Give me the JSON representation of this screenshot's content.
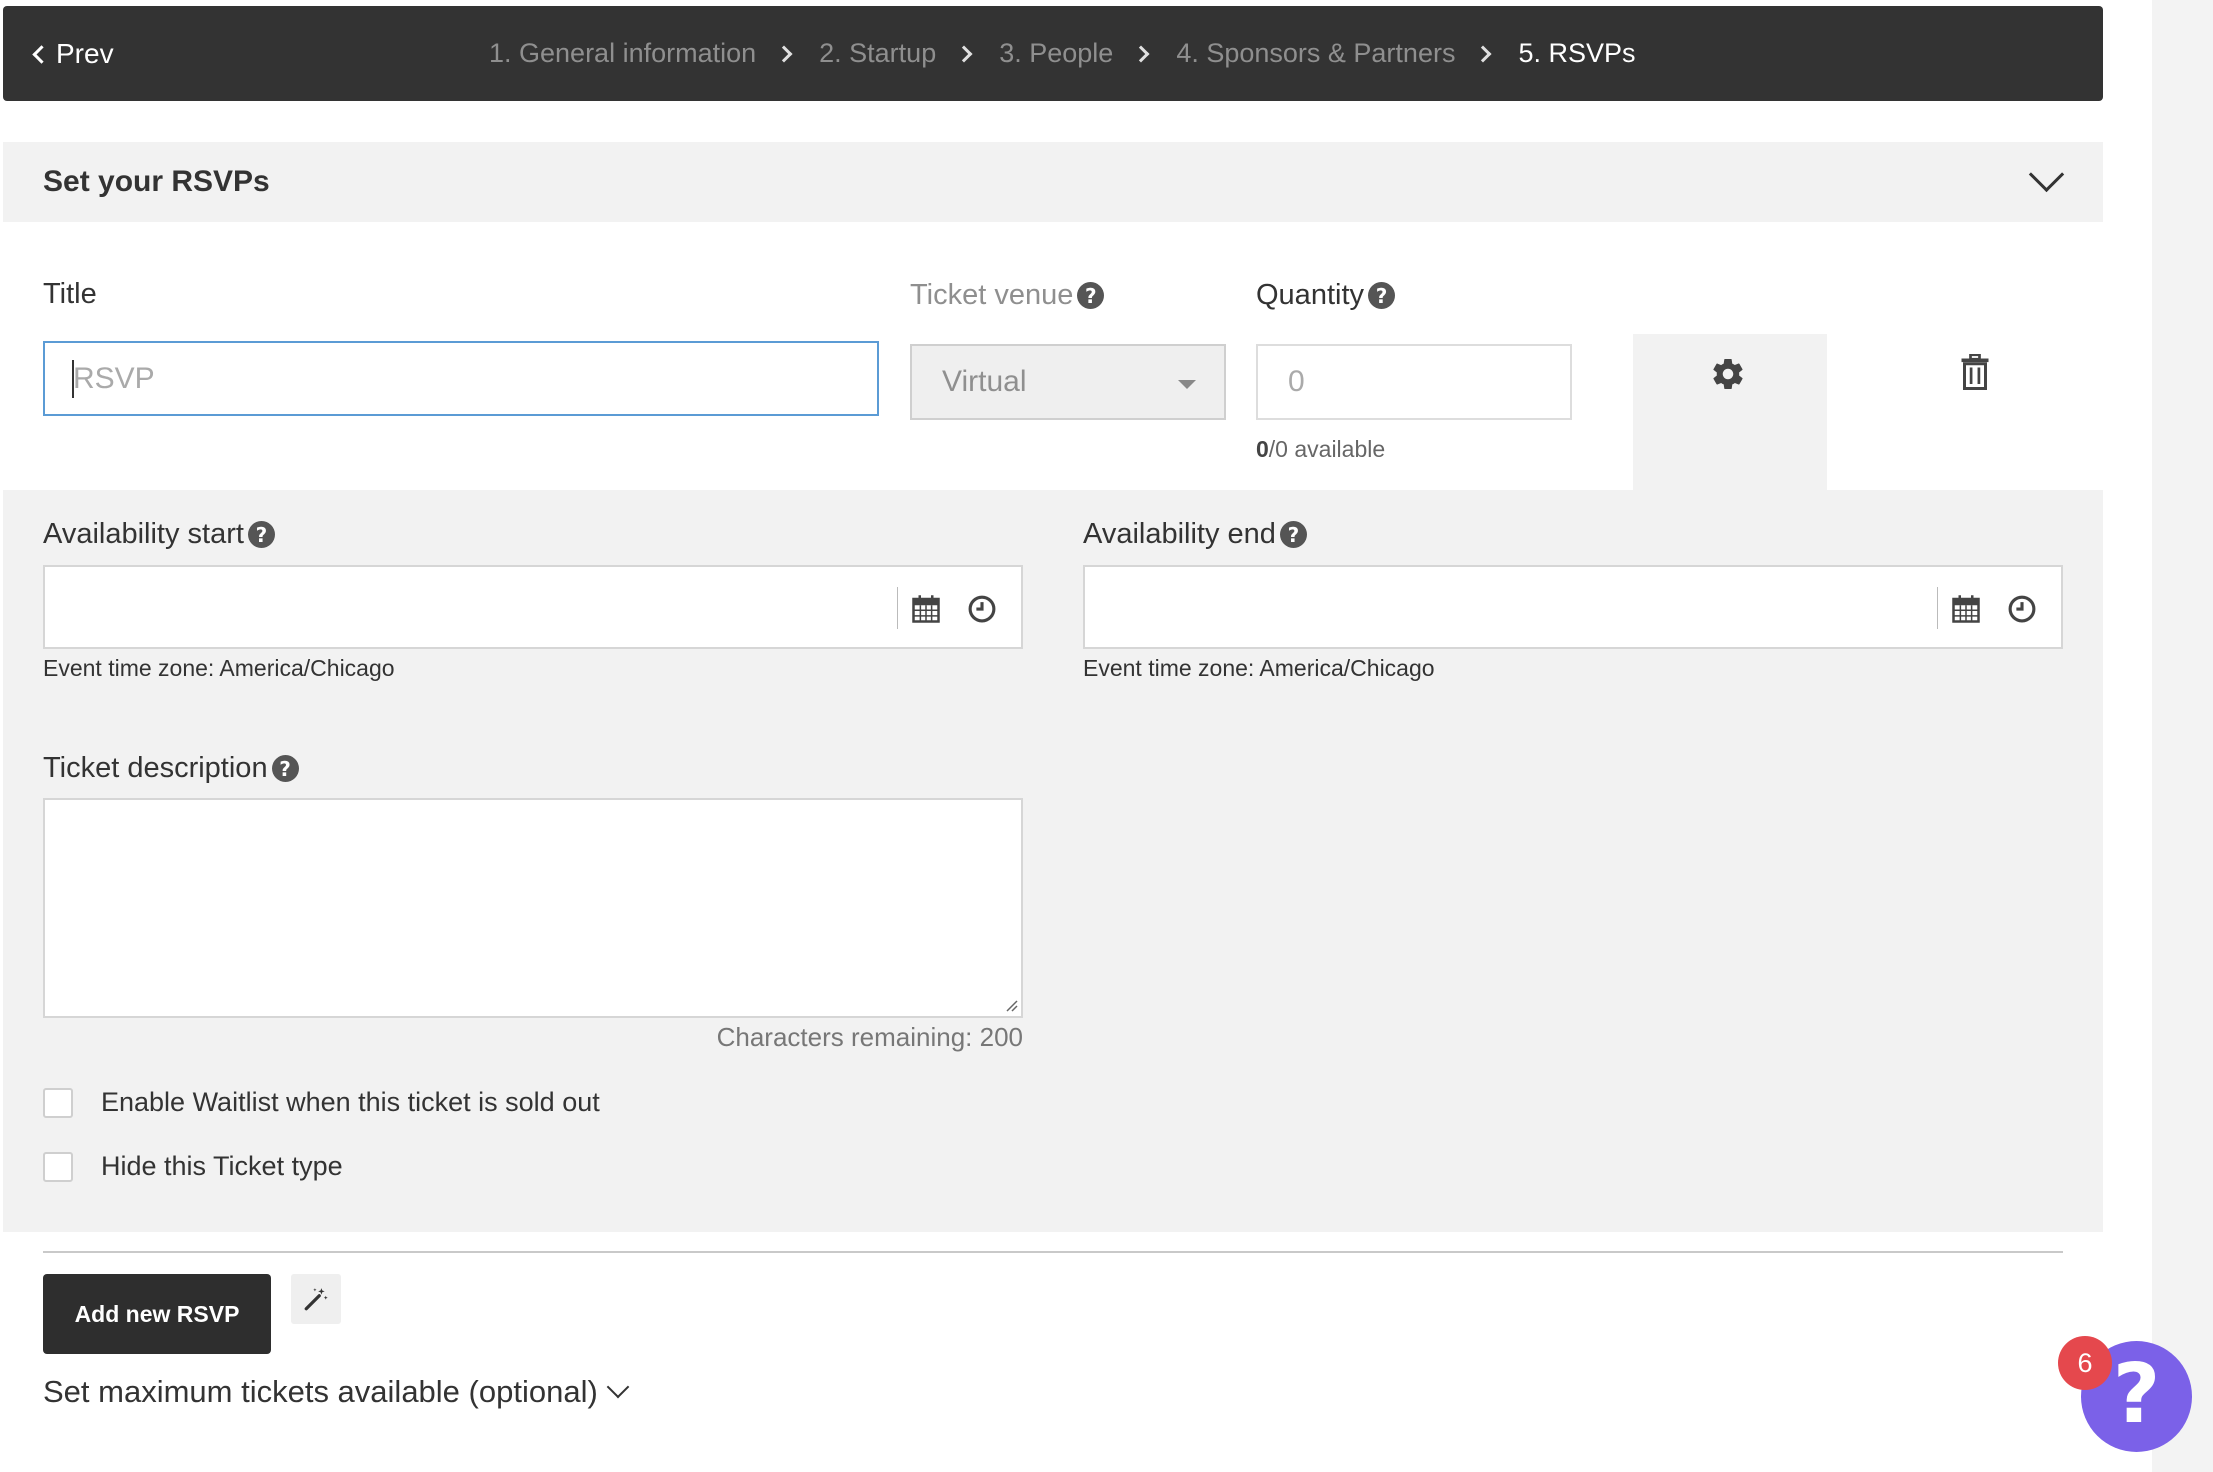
{
  "stepbar": {
    "prev_label": "Prev",
    "steps": [
      {
        "label": "1. General information",
        "active": false
      },
      {
        "label": "2. Startup",
        "active": false
      },
      {
        "label": "3. People",
        "active": false
      },
      {
        "label": "4. Sponsors & Partners",
        "active": false
      },
      {
        "label": "5. RSVPs",
        "active": true
      }
    ]
  },
  "section": {
    "title": "Set your RSVPs",
    "toggle_icon": "chevron-down-icon"
  },
  "form": {
    "title_label": "Title",
    "title_placeholder": "RSVP",
    "title_value": "",
    "venue_label": "Ticket venue",
    "venue_value": "Virtual",
    "quantity_label": "Quantity",
    "quantity_placeholder": "0",
    "available_count": "0",
    "available_rest": "/0 available",
    "settings_icon": "gear-icon",
    "delete_icon": "trash-icon"
  },
  "details": {
    "avail_start_label": "Availability start",
    "avail_end_label": "Availability end",
    "avail_start_value": "",
    "avail_end_value": "",
    "timezone_start": "Event time zone: America/Chicago",
    "timezone_end": "Event time zone: America/Chicago",
    "description_label": "Ticket description",
    "description_value": "",
    "chars_remaining": "Characters remaining: 200",
    "waitlist_label": "Enable Waitlist when this ticket is sold out",
    "waitlist_checked": false,
    "hide_label": "Hide this Ticket type",
    "hide_checked": false
  },
  "footer": {
    "add_button": "Add new RSVP",
    "wand_icon": "magic-wand-icon",
    "max_tickets_label": "Set maximum tickets available (optional)"
  },
  "help_widget": {
    "badge_count": "6",
    "glyph": "?"
  },
  "colors": {
    "dark": "#333333",
    "panel": "#f2f2f2",
    "focus_border": "#5b9bd5",
    "fab": "#7b61e8",
    "badge": "#e5484d"
  }
}
